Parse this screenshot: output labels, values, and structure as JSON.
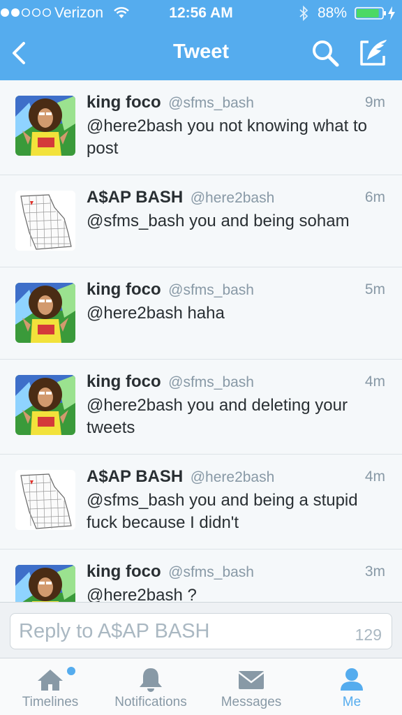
{
  "status_bar": {
    "carrier": "Verizon",
    "time": "12:56 AM",
    "battery": "88%",
    "battery_level": 0.88,
    "signal_bars_filled": 2,
    "signal_bars_total": 5
  },
  "nav": {
    "title": "Tweet",
    "back_icon": "chevron-left-icon",
    "search_icon": "search-icon",
    "compose_icon": "compose-icon"
  },
  "tweets": [
    {
      "name": "king foco",
      "handle": "@sfms_bash",
      "time": "9m",
      "text": "@here2bash you not knowing what to post",
      "avatar": "person-avatar"
    },
    {
      "name": "A$AP BASH",
      "handle": "@here2bash",
      "time": "6m",
      "text": "@sfms_bash you and being soham",
      "avatar": "map-avatar"
    },
    {
      "name": "king foco",
      "handle": "@sfms_bash",
      "time": "5m",
      "text": "@here2bash haha",
      "avatar": "person-avatar"
    },
    {
      "name": "king foco",
      "handle": "@sfms_bash",
      "time": "4m",
      "text": "@here2bash you and deleting your tweets",
      "avatar": "person-avatar"
    },
    {
      "name": "A$AP BASH",
      "handle": "@here2bash",
      "time": "4m",
      "text": "@sfms_bash you and being a stupid fuck because I didn't",
      "avatar": "map-avatar"
    },
    {
      "name": "king foco",
      "handle": "@sfms_bash",
      "time": "3m",
      "text": "@here2bash ?",
      "avatar": "person-avatar"
    }
  ],
  "reply": {
    "placeholder": "Reply to A$AP BASH",
    "char_count": "129"
  },
  "tabs": [
    {
      "label": "Timelines",
      "icon": "home-icon",
      "unread": true
    },
    {
      "label": "Notifications",
      "icon": "bell-icon",
      "unread": false
    },
    {
      "label": "Messages",
      "icon": "envelope-icon",
      "unread": false
    },
    {
      "label": "Me",
      "icon": "person-icon",
      "unread": false,
      "active": true
    }
  ],
  "colors": {
    "brand": "#55acee",
    "text": "#292f33",
    "muted": "#8899a6"
  }
}
